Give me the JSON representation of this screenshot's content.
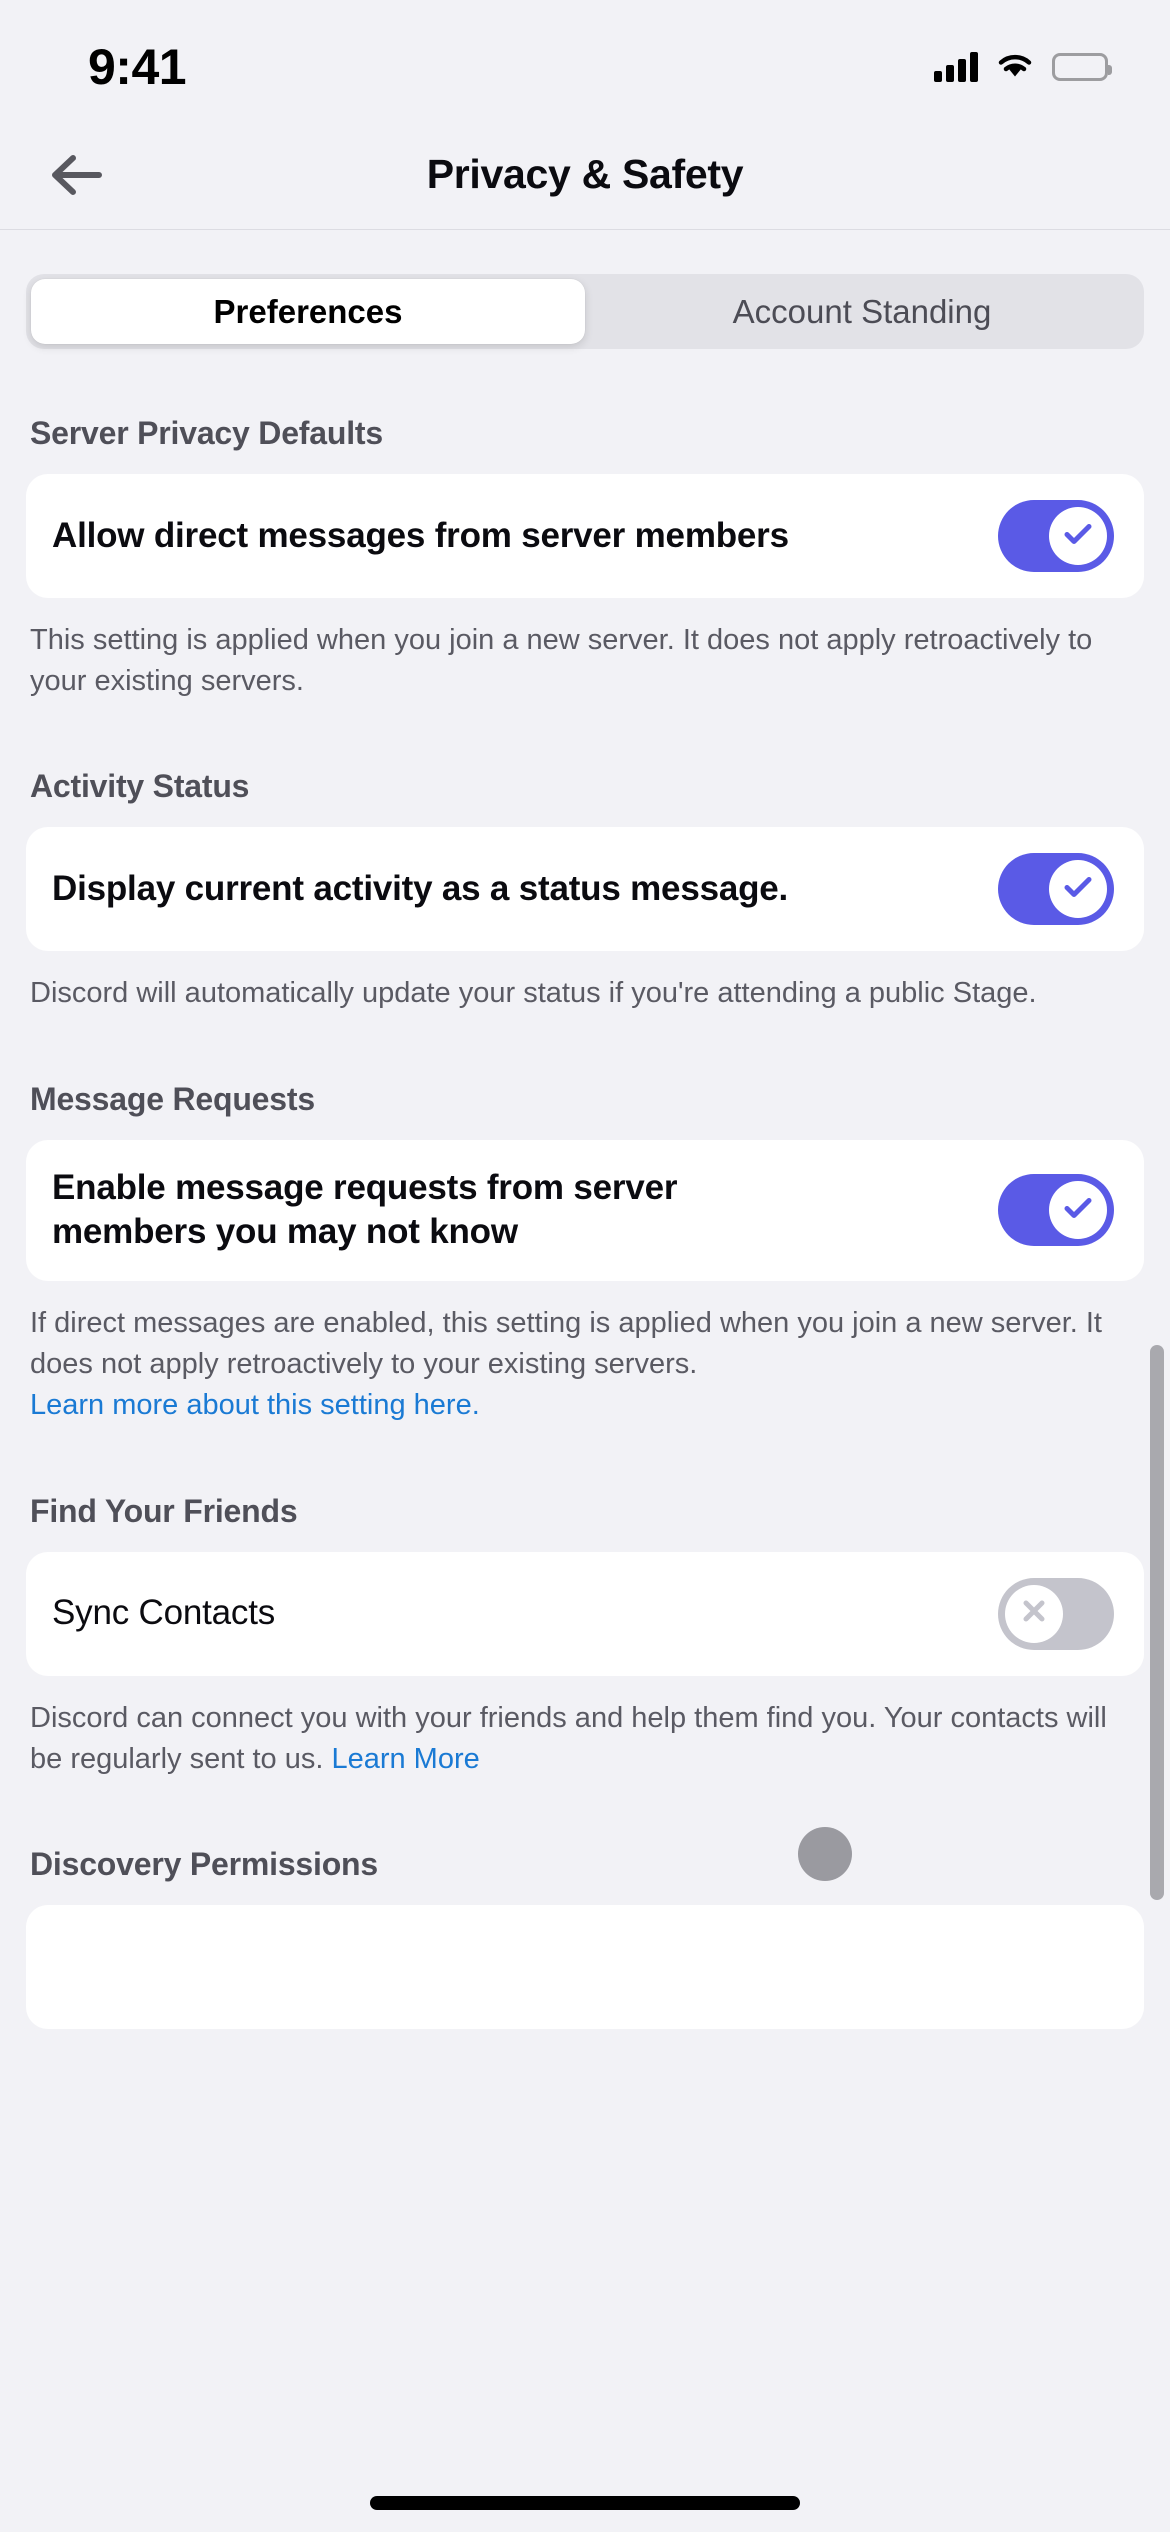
{
  "status_bar": {
    "time": "9:41",
    "cellular_icon": "cellular-bars-icon",
    "wifi_icon": "wifi-icon",
    "battery_icon": "battery-full-icon"
  },
  "nav": {
    "back_icon": "back-arrow-icon",
    "title": "Privacy & Safety"
  },
  "tabs": [
    {
      "label": "Preferences",
      "active": true
    },
    {
      "label": "Account Standing",
      "active": false
    }
  ],
  "sections": [
    {
      "title": "Server Privacy Defaults",
      "row_label": "Allow direct messages from server members",
      "toggle_state": "on",
      "toggle_icon": "checkmark-icon",
      "description": "This setting is applied when you join a new server. It does not apply retroactively to your existing servers.",
      "link": null
    },
    {
      "title": "Activity Status",
      "row_label": "Display current activity as a status message.",
      "toggle_state": "on",
      "toggle_icon": "checkmark-icon",
      "description": "Discord will automatically update your status if you're attending a public Stage.",
      "link": null
    },
    {
      "title": "Message Requests",
      "row_label": "Enable message requests from server members you may not know",
      "toggle_state": "on",
      "toggle_icon": "checkmark-icon",
      "description": "If direct messages are enabled, this setting is applied when you join a new server. It does not apply retroactively to your existing servers.",
      "link": "Learn more about this setting here."
    },
    {
      "title": "Find Your Friends",
      "row_label": "Sync Contacts",
      "toggle_state": "off",
      "toggle_icon": "close-x-icon",
      "description": "Discord can connect you with your friends and help them find you. Your contacts will be regularly sent to us. ",
      "link": "Learn More"
    }
  ],
  "last_section_title": "Discovery Permissions",
  "colors": {
    "page_background": "#f2f2f6",
    "card_background": "#ffffff",
    "toggle_on": "#5a5ae6",
    "toggle_off": "#c4c4cc",
    "link": "#1a7ad4",
    "section_title": "#4f4f58",
    "description": "#5a5a63",
    "scrollbar": "#a9a9ae",
    "touch_cursor": "#9a9aa0"
  }
}
